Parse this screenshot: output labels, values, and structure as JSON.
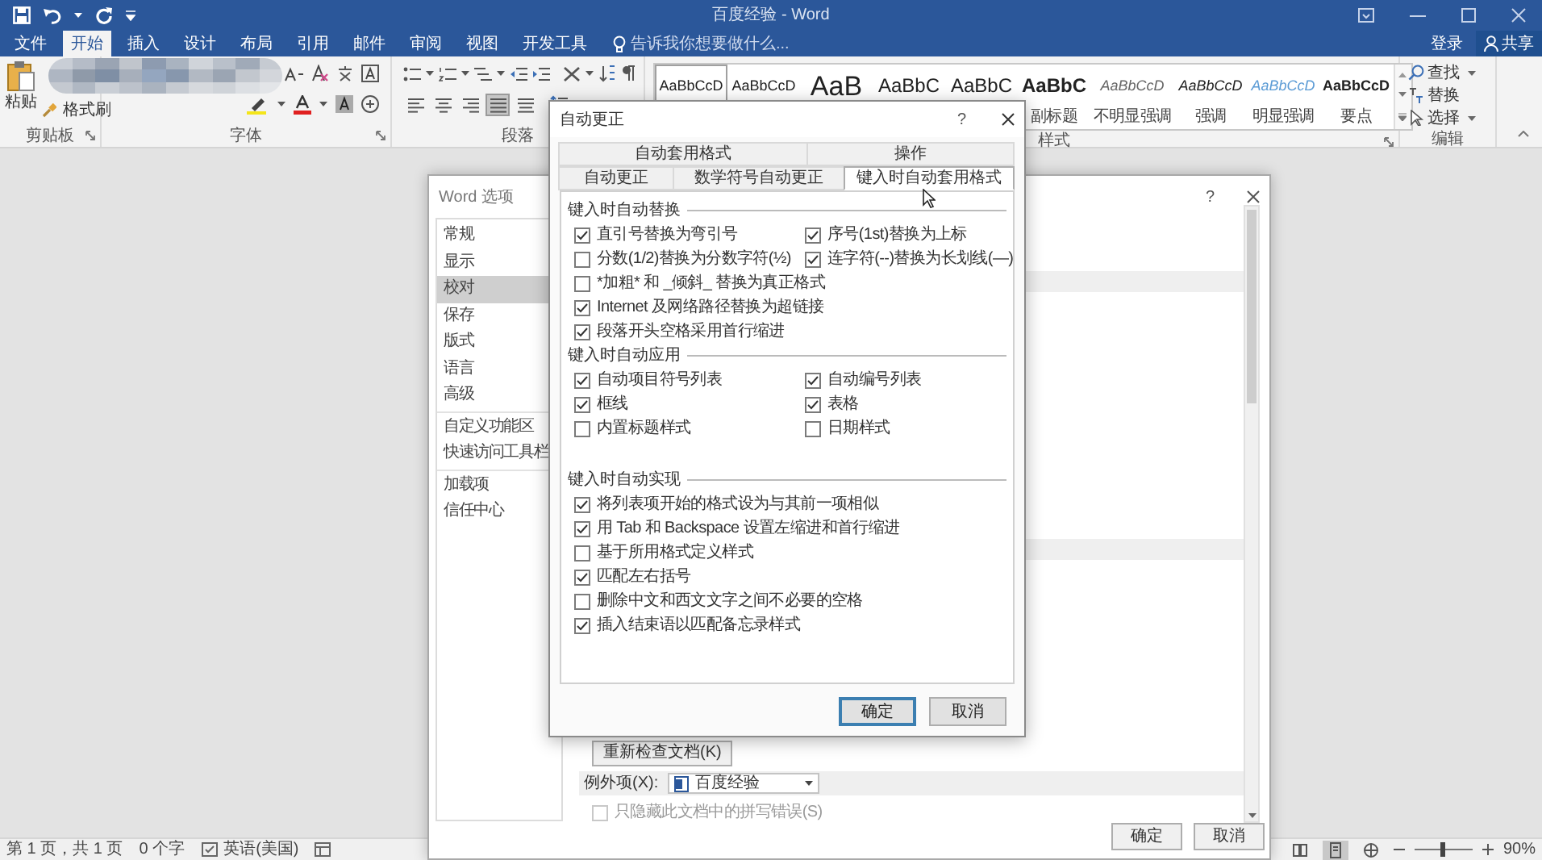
{
  "window": {
    "title": "百度经验 - Word"
  },
  "ribbon_tabs": [
    {
      "label": "文件",
      "selected": false
    },
    {
      "label": "开始",
      "selected": true
    },
    {
      "label": "插入",
      "selected": false
    },
    {
      "label": "设计",
      "selected": false
    },
    {
      "label": "布局",
      "selected": false
    },
    {
      "label": "引用",
      "selected": false
    },
    {
      "label": "邮件",
      "selected": false
    },
    {
      "label": "审阅",
      "selected": false
    },
    {
      "label": "视图",
      "selected": false
    },
    {
      "label": "开发工具",
      "selected": false
    }
  ],
  "tell_me": {
    "placeholder": "告诉我你想要做什么..."
  },
  "account": {
    "sign_in": "登录",
    "share": "共享"
  },
  "clipboard": {
    "paste": "粘贴",
    "format_painter": "格式刷",
    "label": "剪贴板"
  },
  "font": {
    "label": "字体"
  },
  "paragraph": {
    "label": "段落",
    "alignment": [
      {
        "selected": false
      },
      {
        "selected": false
      },
      {
        "selected": false
      },
      {
        "selected": true
      },
      {
        "selected": false
      }
    ]
  },
  "styles": {
    "label": "样式",
    "items": [
      {
        "sample": "AaBbCcD",
        "kind": "normal",
        "selected": true
      },
      {
        "sample": "AaBbCcD",
        "kind": "normal",
        "selected": false
      },
      {
        "sample": "AaB",
        "kind": "title",
        "selected": false
      },
      {
        "sample": "AaBbC",
        "kind": "heading",
        "selected": false
      },
      {
        "sample": "AaBbC",
        "kind": "heading",
        "selected": false
      },
      {
        "sample": "AaBbC",
        "kind": "heading-bold",
        "label": "副标题",
        "selected": false
      },
      {
        "sample": "AaBbCcD",
        "kind": "subtle",
        "label": "不明显强调",
        "selected": false
      },
      {
        "sample": "AaBbCcD",
        "kind": "emphasis",
        "label": "强调",
        "selected": false
      },
      {
        "sample": "AaBbCcD",
        "kind": "intense",
        "label": "明显强调",
        "selected": false
      },
      {
        "sample": "AaBbCcD",
        "kind": "strong",
        "label": "要点",
        "selected": false
      }
    ]
  },
  "editing": {
    "label": "编辑",
    "find": "查找",
    "replace": "替换",
    "select": "选择"
  },
  "word_options": {
    "title": "Word 选项",
    "help": "?",
    "nav_groups": [
      [
        {
          "label": "常规",
          "selected": false
        },
        {
          "label": "显示",
          "selected": false
        },
        {
          "label": "校对",
          "selected": true
        },
        {
          "label": "保存",
          "selected": false
        },
        {
          "label": "版式",
          "selected": false
        },
        {
          "label": "语言",
          "selected": false
        },
        {
          "label": "高级",
          "selected": false
        }
      ],
      [
        {
          "label": "自定义功能区",
          "selected": false
        },
        {
          "label": "快速访问工具栏",
          "selected": false
        }
      ],
      [
        {
          "label": "加载项",
          "selected": false
        },
        {
          "label": "信任中心",
          "selected": false
        }
      ]
    ],
    "recheck_button": "重新检查文档(K)",
    "exceptions": {
      "label": "例外项(X):",
      "value": "百度经验"
    },
    "hide_errors": {
      "label": "只隐藏此文档中的拼写错误(S)",
      "checked": false,
      "disabled": true
    },
    "buttons": [
      "确定",
      "取消"
    ]
  },
  "autocorrect": {
    "title": "自动更正",
    "help": "?",
    "tab_rows": [
      [
        {
          "label": "自动套用格式",
          "selected": false
        },
        {
          "label": "操作",
          "selected": false
        }
      ],
      [
        {
          "label": "自动更正",
          "selected": false
        },
        {
          "label": "数学符号自动更正",
          "selected": false
        },
        {
          "label": "键入时自动套用格式",
          "selected": true
        }
      ]
    ],
    "sections": [
      {
        "title": "键入时自动替换",
        "rows": [
          [
            {
              "label": "直引号替换为弯引号",
              "checked": true
            },
            {
              "label": "序号(1st)替换为上标",
              "checked": true
            }
          ],
          [
            {
              "label": "分数(1/2)替换为分数字符(½)",
              "checked": false
            },
            {
              "label": "连字符(--)替换为长划线(—)",
              "checked": true
            }
          ],
          [
            {
              "label": "*加粗* 和 _倾斜_ 替换为真正格式",
              "checked": false
            }
          ],
          [
            {
              "label": "Internet 及网络路径替换为超链接",
              "checked": true
            }
          ],
          [
            {
              "label": "段落开头空格采用首行缩进",
              "checked": true
            }
          ]
        ]
      },
      {
        "title": "键入时自动应用",
        "rows": [
          [
            {
              "label": "自动项目符号列表",
              "checked": true
            },
            {
              "label": "自动编号列表",
              "checked": true
            }
          ],
          [
            {
              "label": "框线",
              "checked": true
            },
            {
              "label": "表格",
              "checked": true
            }
          ],
          [
            {
              "label": "内置标题样式",
              "checked": false
            },
            {
              "label": "日期样式",
              "checked": false
            }
          ]
        ]
      },
      {
        "title": "键入时自动实现",
        "rows": [
          [
            {
              "label": "将列表项开始的格式设为与其前一项相似",
              "checked": true
            }
          ],
          [
            {
              "label": "用 Tab 和 Backspace 设置左缩进和首行缩进",
              "checked": true
            }
          ],
          [
            {
              "label": "基于所用格式定义样式",
              "checked": false
            }
          ],
          [
            {
              "label": "匹配左右括号",
              "checked": true
            }
          ],
          [
            {
              "label": "删除中文和西文文字之间不必要的空格",
              "checked": false
            }
          ],
          [
            {
              "label": "插入结束语以匹配备忘录样式",
              "checked": true
            }
          ]
        ]
      }
    ],
    "buttons": [
      {
        "label": "确定",
        "default": true
      },
      {
        "label": "取消",
        "default": false
      }
    ]
  },
  "status_bar": {
    "page": "第 1 页，共 1 页",
    "words": "0 个字",
    "language": "英语(美国)",
    "views": [
      {
        "selected": false
      },
      {
        "selected": true
      },
      {
        "selected": false
      }
    ],
    "zoom": {
      "level": 0.47
    },
    "zoom_text": "90%"
  }
}
